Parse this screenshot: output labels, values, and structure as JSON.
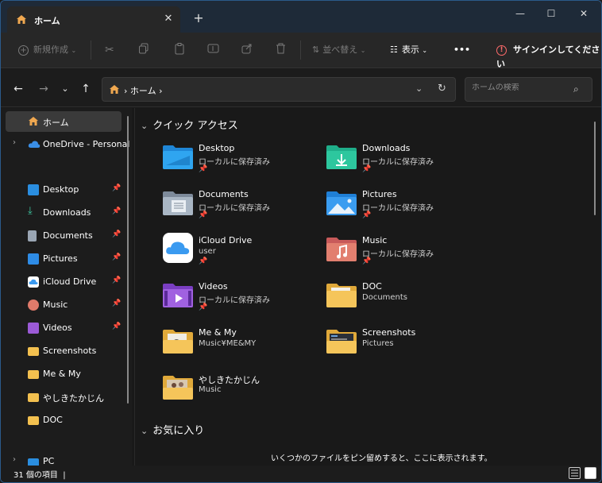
{
  "tab": {
    "title": "ホーム",
    "close": "✕",
    "new_tab": "+"
  },
  "window_controls": {
    "minimize": "—",
    "maximize": "☐",
    "close": "✕"
  },
  "toolbar": {
    "new_label": "新規作成",
    "sort_label": "並べ替え",
    "view_label": "表示",
    "more_label": "•••",
    "signin_label": "サインインしてください"
  },
  "address": {
    "crumb": "ホーム"
  },
  "search": {
    "placeholder": "ホームの検索"
  },
  "sidebar": {
    "items": [
      {
        "label": "ホーム",
        "selected": true
      },
      {
        "label": "OneDrive - Personal"
      },
      {
        "label": "Desktop",
        "pinned": true
      },
      {
        "label": "Downloads",
        "pinned": true
      },
      {
        "label": "Documents",
        "pinned": true
      },
      {
        "label": "Pictures",
        "pinned": true
      },
      {
        "label": "iCloud Drive",
        "pinned": true
      },
      {
        "label": "Music",
        "pinned": true
      },
      {
        "label": "Videos",
        "pinned": true
      },
      {
        "label": "Screenshots"
      },
      {
        "label": "Me & My"
      },
      {
        "label": "やしきたかじん"
      },
      {
        "label": "DOC"
      },
      {
        "label": "PC"
      }
    ]
  },
  "main": {
    "quick_access_title": "クイック アクセス",
    "favorites_title": "お気に入り",
    "favorites_empty": "いくつかのファイルをピン留めすると、ここに表示されます。",
    "items": [
      {
        "name": "Desktop",
        "sub": "ローカルに保存済み",
        "pinned": true
      },
      {
        "name": "Downloads",
        "sub": "ローカルに保存済み",
        "pinned": true
      },
      {
        "name": "Documents",
        "sub": "ローカルに保存済み",
        "pinned": true
      },
      {
        "name": "Pictures",
        "sub": "ローカルに保存済み",
        "pinned": true
      },
      {
        "name": "iCloud Drive",
        "sub": "user",
        "pinned": true
      },
      {
        "name": "Music",
        "sub": "ローカルに保存済み",
        "pinned": true
      },
      {
        "name": "Videos",
        "sub": "ローカルに保存済み",
        "pinned": true
      },
      {
        "name": "DOC",
        "sub": "Documents"
      },
      {
        "name": "Me & My",
        "sub": "Music¥ME&MY"
      },
      {
        "name": "Screenshots",
        "sub": "Pictures"
      },
      {
        "name": "やしきたかじん",
        "sub": "Music"
      }
    ]
  },
  "status": {
    "count": "31 個の項目"
  }
}
